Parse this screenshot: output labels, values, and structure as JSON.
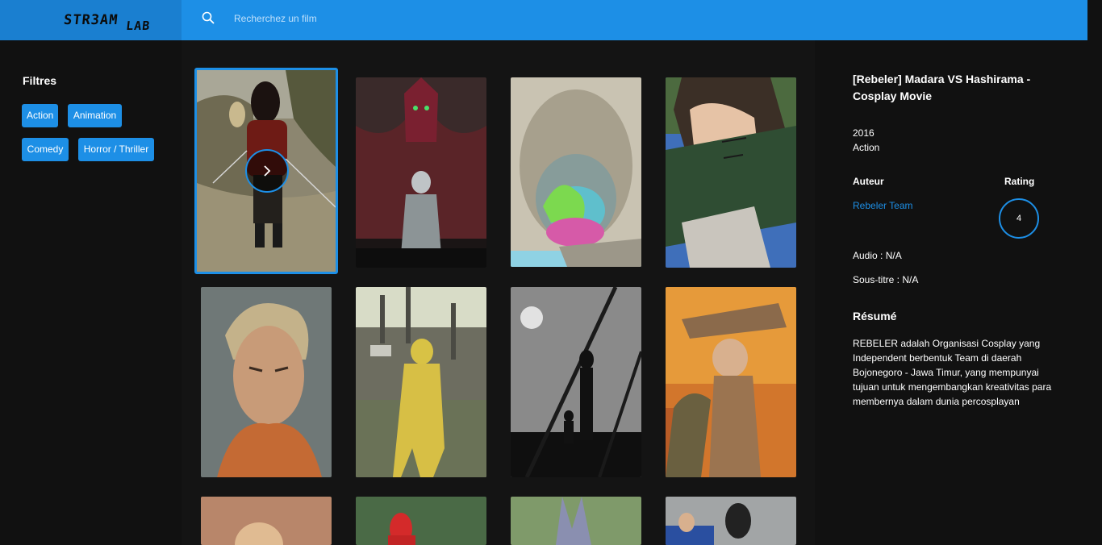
{
  "header": {
    "logo_text": "STR3AM",
    "logo_text_small": "LAB",
    "search_placeholder": "Recherchez un film"
  },
  "sidebar": {
    "title": "Filtres",
    "filters": [
      "Action",
      "Animation",
      "Comedy",
      "Horror / Thriller"
    ]
  },
  "movie": {
    "title": "[Rebeler] Madara VS Hashirama - Cosplay Movie",
    "year": "2016",
    "genre": "Action",
    "author_label": "Auteur",
    "author": "Rebeler Team",
    "rating_label": "Rating",
    "rating": "4",
    "audio": "Audio : N/A",
    "subtitle": "Sous-titre : N/A",
    "summary_label": "Résumé",
    "summary": "REBELER adalah Organisasi Cosplay yang Independent berbentuk Team di daerah Bojonegoro - Jawa Timur, yang mempunyai tujuan untuk mengembangkan kreativitas para membernya dalam dunia percosplayan"
  },
  "colors": {
    "accent": "#1d8fe6",
    "background": "#111111"
  },
  "icons": {
    "search": "search-icon",
    "play": "play-icon"
  }
}
